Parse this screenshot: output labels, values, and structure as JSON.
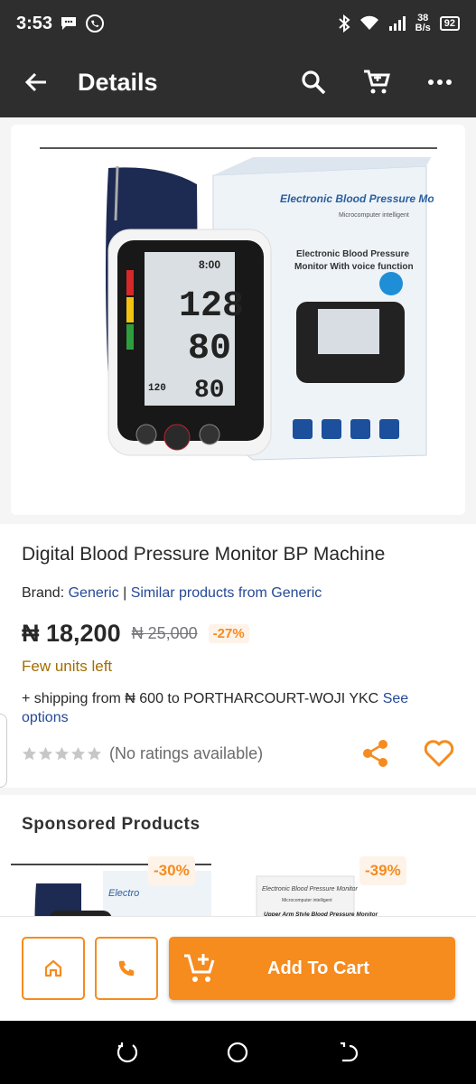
{
  "status_bar": {
    "time": "3:53",
    "net_speed_value": "38",
    "net_speed_unit": "B/s",
    "battery": "92"
  },
  "app_bar": {
    "title": "Details",
    "back_icon": "arrow-left-icon",
    "search_icon": "search-icon",
    "cart_icon": "cart-icon",
    "more_icon": "more-vertical-icon"
  },
  "product": {
    "image_box_title": "Electronic Blood Pressure Monitor",
    "image_box_subtitle": "Microcomputer intelligent",
    "image_box_caption_1": "Electronic Blood Pressure",
    "image_box_caption_2": "Monitor With voice function",
    "lcd_time": "8:00",
    "lcd_sys": "128",
    "lcd_dia": "80",
    "lcd_pul": "80",
    "lcd_small": "120",
    "name": "Digital Blood Pressure Monitor BP Machine",
    "brand_label": "Brand:",
    "brand_name": "Generic",
    "brand_separator": "|",
    "similar_link": "Similar products from Generic",
    "price": "₦ 18,200",
    "old_price": "₦ 25,000",
    "discount": "-27%",
    "stock_status": "Few units left",
    "shipping_text": "+ shipping from ₦ 600 to PORTHARCOURT-WOJI YKC",
    "shipping_link": "See options",
    "ratings_text": "(No ratings available)",
    "rating": 0,
    "rating_max": 5
  },
  "sponsored": {
    "heading": "Sponsored Products",
    "items": [
      {
        "discount": "-30%",
        "thumb_text": "Electro"
      },
      {
        "discount": "-39%",
        "thumb_title": "Electronic Blood Pressure Monitor",
        "thumb_sub": "Microcomputer intelligent",
        "thumb_caption": "Upper Arm Style Blood Pressure Monitor"
      }
    ]
  },
  "bottom_bar": {
    "home_icon": "home-icon",
    "phone_icon": "phone-icon",
    "add_to_cart": "Add To Cart"
  },
  "colors": {
    "accent": "#f68b1e",
    "link": "#264996",
    "stock": "#a26d00",
    "appbar": "#2e2e2e"
  }
}
